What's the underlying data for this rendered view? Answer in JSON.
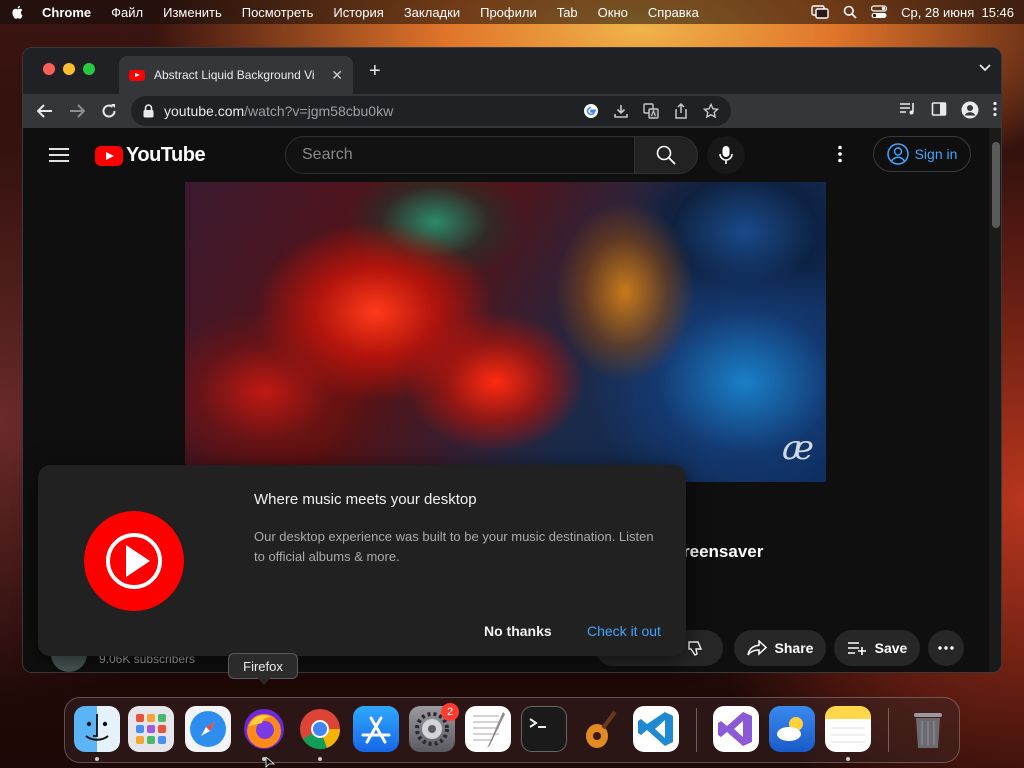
{
  "menubar": {
    "app": "Chrome",
    "items": [
      "Файл",
      "Изменить",
      "Посмотреть",
      "История",
      "Закладки",
      "Профили",
      "Tab",
      "Окно",
      "Справка"
    ],
    "clock": "Ср, 28 июня  15:46"
  },
  "browser": {
    "tab_title": "Abstract Liquid Background Vi",
    "url_host": "youtube.com",
    "url_path": "/watch?v=jgm58cbu0kw"
  },
  "youtube": {
    "logo_text": "YouTube",
    "search_placeholder": "Search",
    "signin_label": "Sign in",
    "watermark": "æ",
    "video_title_fragment": "reensaver",
    "subscribers": "9.06K subscribers",
    "share_label": "Share",
    "save_label": "Save"
  },
  "popup": {
    "title": "Where music meets your desktop",
    "body": "Our desktop experience was built to be your music destination. Listen to official albums & more.",
    "dismiss_label": "No thanks",
    "confirm_label": "Check it out"
  },
  "dock": {
    "tooltip": "Firefox",
    "settings_badge": "2",
    "apps": [
      "Finder",
      "Launchpad",
      "Safari",
      "Firefox",
      "Chrome",
      "App Store",
      "System Settings",
      "TextEdit",
      "Terminal",
      "GarageBand",
      "Visual Studio Code",
      "Visual Studio",
      "Weather",
      "Notes",
      "Trash"
    ]
  },
  "colors": {
    "youtube_red": "#ff0000",
    "link_blue": "#3ea6ff",
    "yt_background": "#0f0f0f"
  }
}
